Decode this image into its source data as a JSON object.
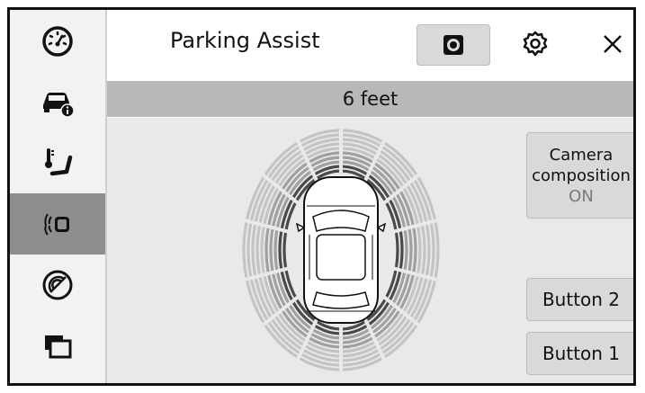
{
  "header": {
    "title": "Parking Assist",
    "camera_button_icon": "camera-icon",
    "settings_icon": "gear-icon",
    "close_icon": "close-icon"
  },
  "distance": {
    "label": "6 feet"
  },
  "sidebar": {
    "active_index": 3,
    "items": [
      {
        "icon": "speedometer-icon"
      },
      {
        "icon": "vehicle-info-icon"
      },
      {
        "icon": "heated-seat-icon"
      },
      {
        "icon": "parking-sensor-icon"
      },
      {
        "icon": "radar-icon"
      },
      {
        "icon": "multi-window-icon"
      }
    ]
  },
  "buttons": {
    "camera_composition": {
      "line1": "Camera",
      "line2": "composition",
      "state": "ON"
    },
    "button2": "Button 2",
    "button1": "Button 1"
  },
  "colors": {
    "active_sidebar": "#8e8e8e",
    "distance_bar": "#b8b8b8",
    "button_bg": "#d9d9d9",
    "zone_outer": "#c4c4c4",
    "zone_middle": "#a0a0a0",
    "zone_inner": "#4a4a4a"
  }
}
